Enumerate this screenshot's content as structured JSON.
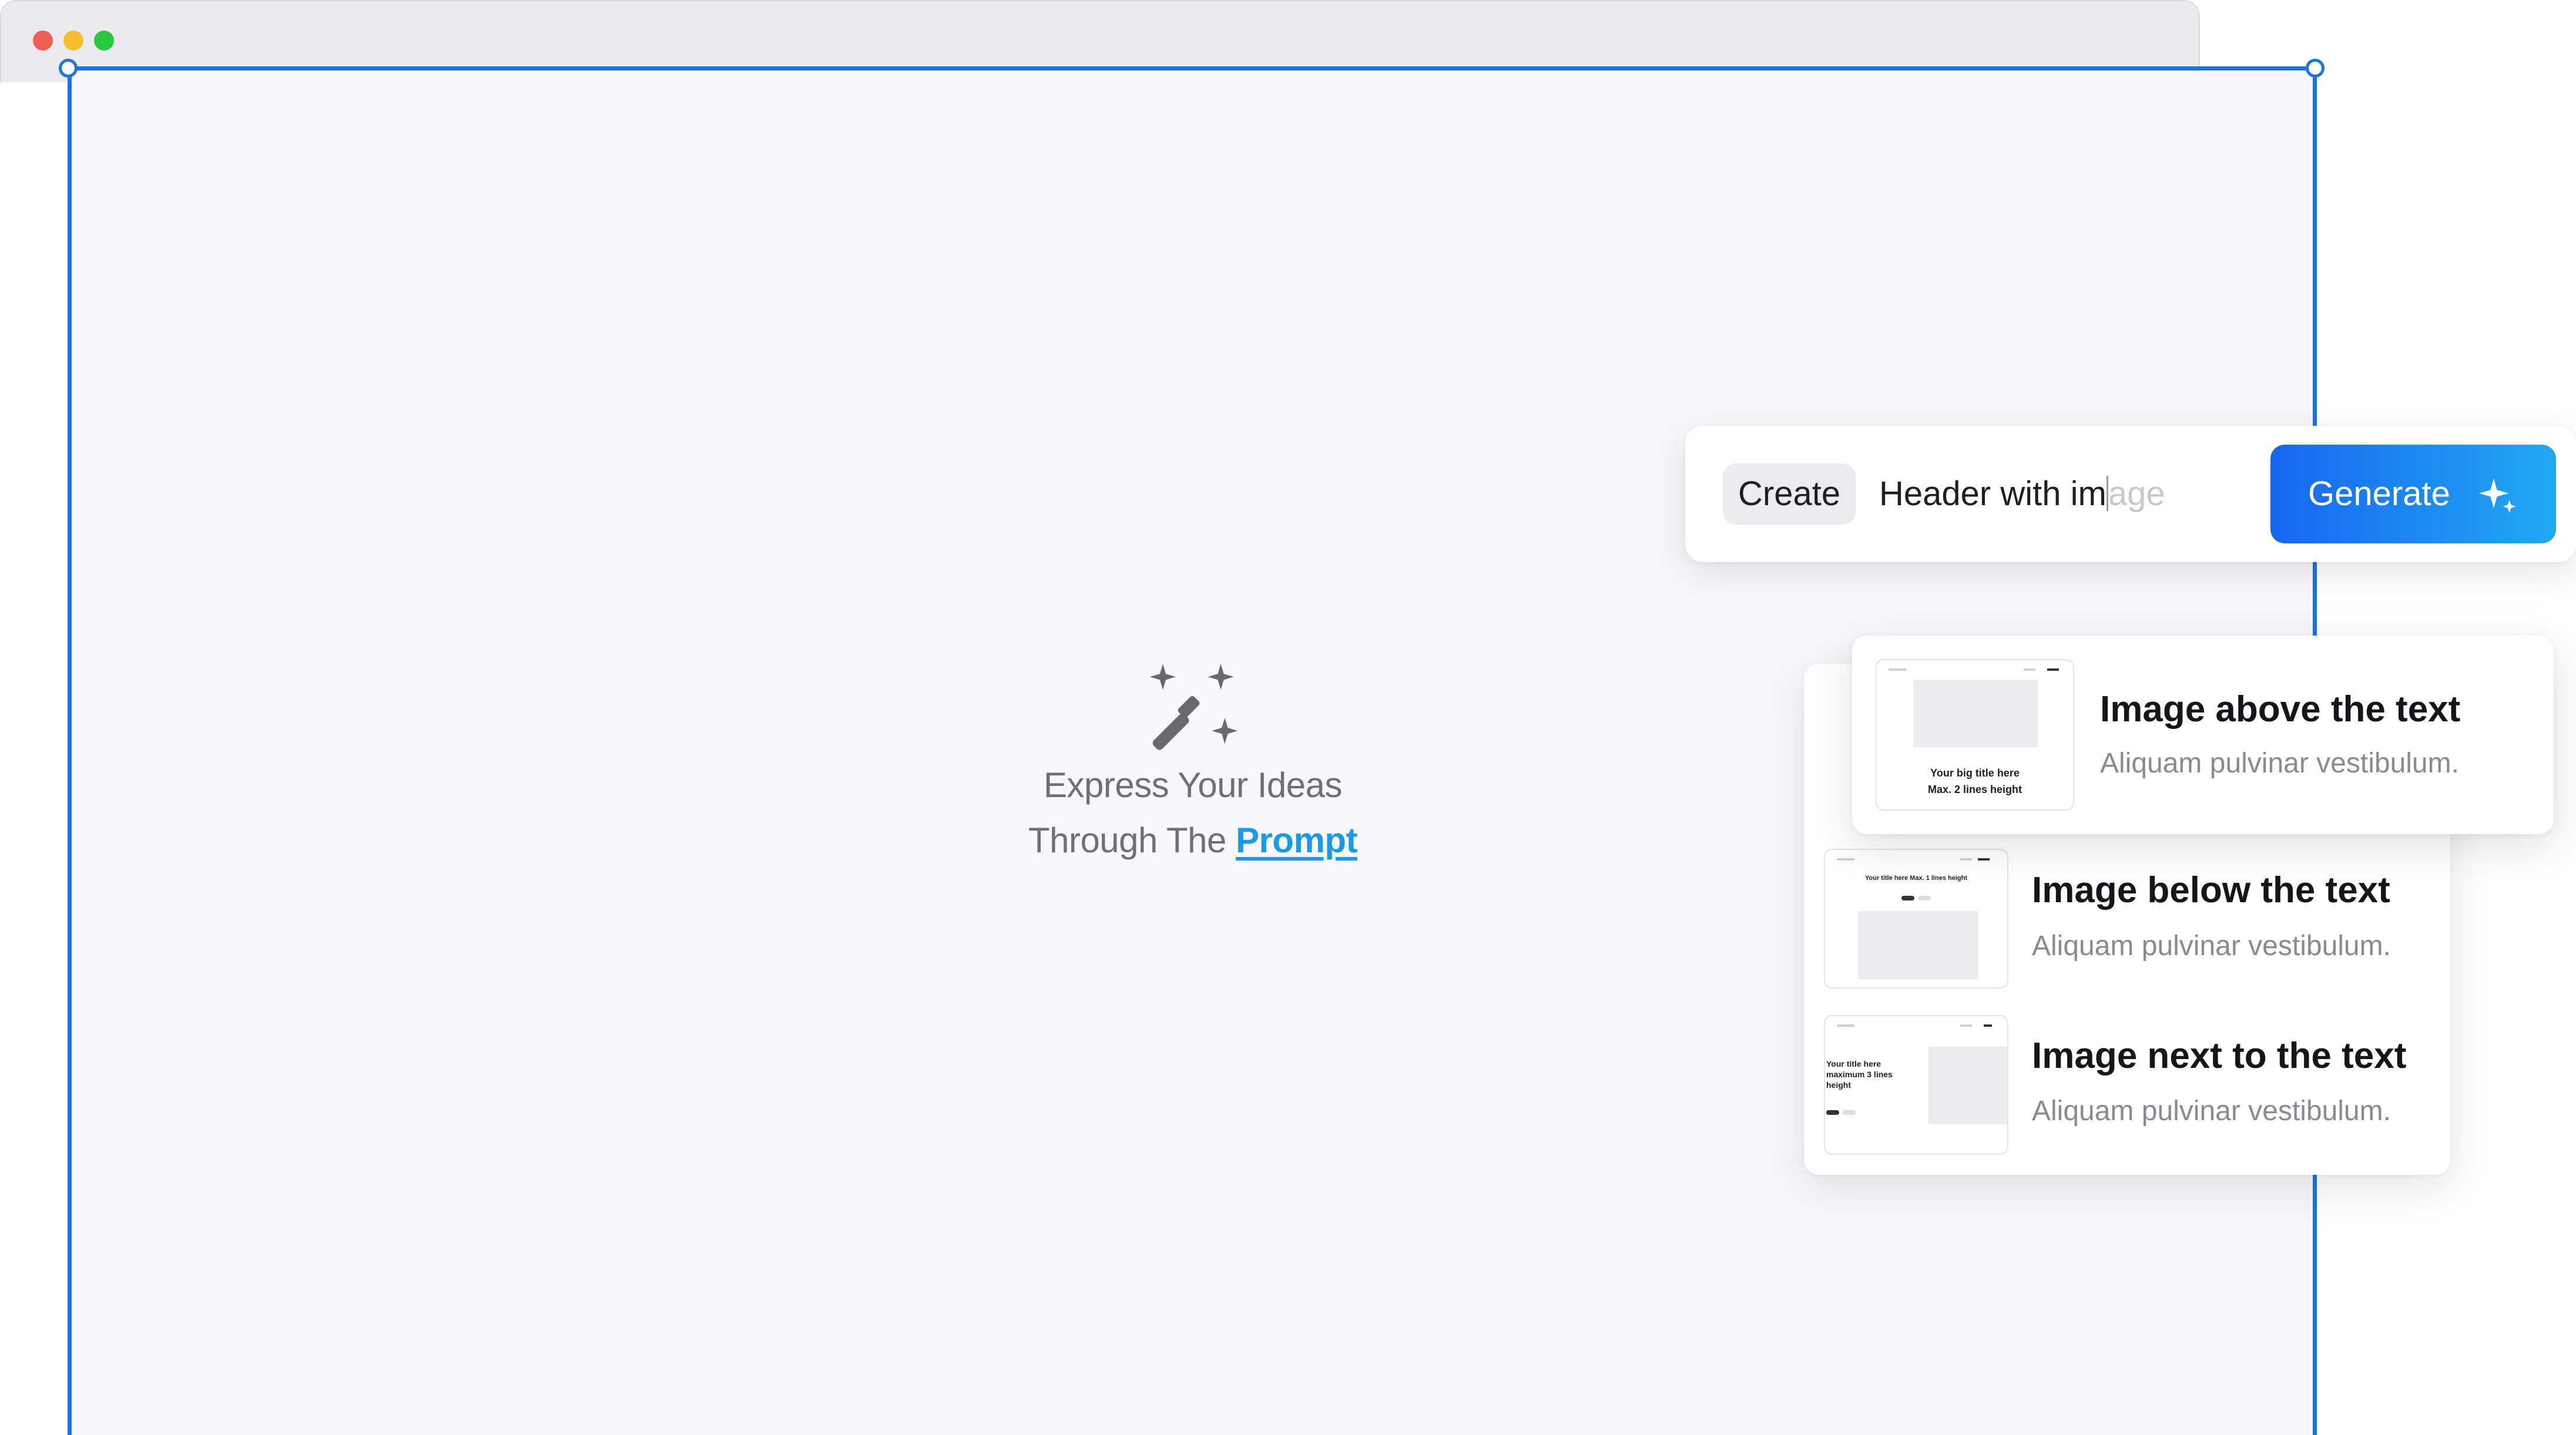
{
  "prompt_bar": {
    "chip_label": "Create",
    "typed_text": "Header with im",
    "ghost_text": "age",
    "generate_label": "Generate"
  },
  "empty_state": {
    "line1": "Express Your Ideas",
    "line2_prefix": "Through The",
    "link_text": "Prompt"
  },
  "options": [
    {
      "title": "Image above the text",
      "subtitle": "Aliquam pulvinar vestibulum.",
      "thumb_title_line1": "Your big title here",
      "thumb_title_line2": "Max. 2 lines height"
    },
    {
      "title": "Image below the text",
      "subtitle": "Aliquam pulvinar vestibulum.",
      "thumb_title": "Your title here Max. 1 lines height"
    },
    {
      "title": "Image next to the text",
      "subtitle": "Aliquam pulvinar vestibulum.",
      "thumb_title_line1": "Your title here",
      "thumb_title_line2": "maximum 3 lines",
      "thumb_title_line3": "height"
    }
  ],
  "colors": {
    "accent": "#1a73e8",
    "link": "#1a9be8",
    "gradient_start": "#1766f0",
    "gradient_end": "#21a9f2"
  },
  "icons": {
    "wand": "magic-wand-icon",
    "sparkle": "sparkle-icon"
  }
}
